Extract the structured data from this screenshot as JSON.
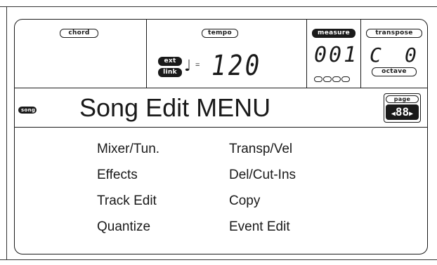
{
  "status": {
    "chord_label": "chord",
    "tempo_label": "tempo",
    "ext_label": "ext",
    "link_label": "link",
    "note_symbol": "♩",
    "equals": "=",
    "tempo_value": "120",
    "measure_label": "measure",
    "measure_value": "001",
    "beat_count": 4,
    "transpose_label": "transpose",
    "transpose_key": "C",
    "transpose_value": "0",
    "octave_label": "octave"
  },
  "titlebar": {
    "mode_label": "song",
    "title": "Song Edit MENU",
    "page_label": "page",
    "page_value": "88",
    "page_prev_icon": "arrow-left",
    "page_next_icon": "arrow-right"
  },
  "menu": {
    "left": [
      "Mixer/Tun.",
      "Effects",
      "Track Edit",
      "Quantize"
    ],
    "right": [
      "Transp/Vel",
      "Del/Cut-Ins",
      "Copy",
      "Event Edit"
    ]
  },
  "colors": {
    "ink": "#1a1a1a",
    "background": "#ffffff"
  }
}
